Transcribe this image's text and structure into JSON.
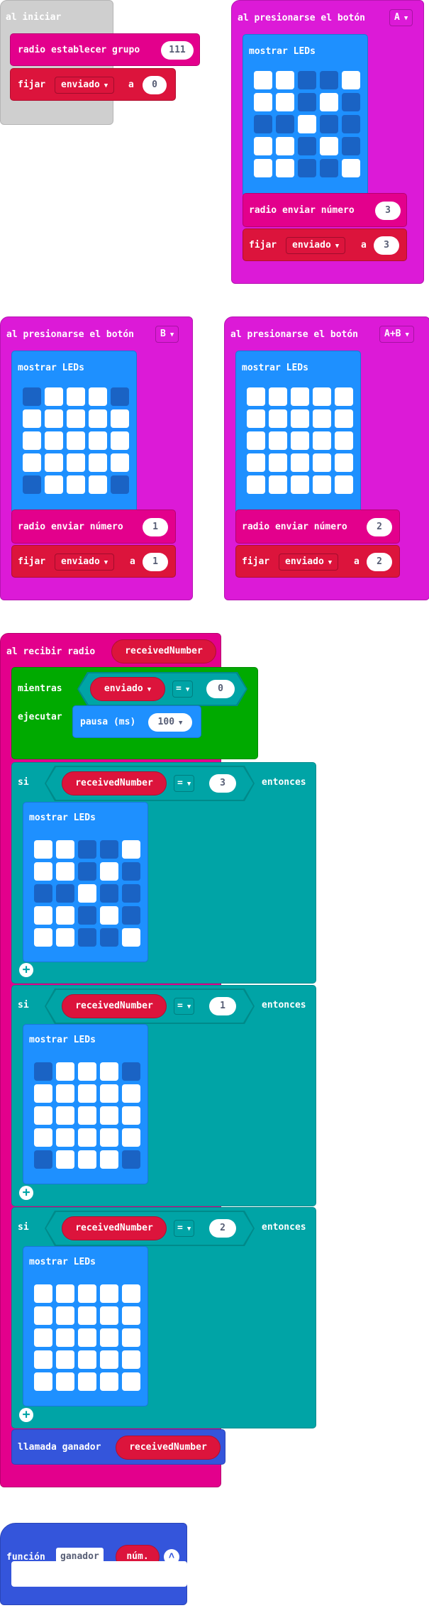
{
  "on_start": {
    "hat_label": "al iniciar",
    "set_group_label": "radio establecer grupo",
    "group_value": "111",
    "set_label": "fijar",
    "variable": "enviado",
    "to_label": "a",
    "set_value": "0"
  },
  "button_a": {
    "hat_label": "al presionarse el botón",
    "button": "A",
    "show_leds_label": "mostrar LEDs",
    "leds": [
      [
        1,
        1,
        0,
        0,
        1
      ],
      [
        1,
        1,
        0,
        1,
        0
      ],
      [
        0,
        0,
        1,
        0,
        0
      ],
      [
        1,
        1,
        0,
        1,
        0
      ],
      [
        1,
        1,
        0,
        0,
        1
      ]
    ],
    "send_label": "radio enviar número",
    "send_value": "3",
    "set_label": "fijar",
    "variable": "enviado",
    "to_label": "a",
    "set_value": "3"
  },
  "button_b": {
    "hat_label": "al presionarse el botón",
    "button": "B",
    "show_leds_label": "mostrar LEDs",
    "leds": [
      [
        0,
        1,
        1,
        1,
        0
      ],
      [
        1,
        1,
        1,
        1,
        1
      ],
      [
        1,
        1,
        1,
        1,
        1
      ],
      [
        1,
        1,
        1,
        1,
        1
      ],
      [
        0,
        1,
        1,
        1,
        0
      ]
    ],
    "send_label": "radio enviar número",
    "send_value": "1",
    "set_label": "fijar",
    "variable": "enviado",
    "to_label": "a",
    "set_value": "1"
  },
  "button_ab": {
    "hat_label": "al presionarse el botón",
    "button": "A+B",
    "show_leds_label": "mostrar LEDs",
    "leds": [
      [
        1,
        1,
        1,
        1,
        1
      ],
      [
        1,
        1,
        1,
        1,
        1
      ],
      [
        1,
        1,
        1,
        1,
        1
      ],
      [
        1,
        1,
        1,
        1,
        1
      ],
      [
        1,
        1,
        1,
        1,
        1
      ]
    ],
    "send_label": "radio enviar número",
    "send_value": "2",
    "set_label": "fijar",
    "variable": "enviado",
    "to_label": "a",
    "set_value": "2"
  },
  "on_received": {
    "hat_label": "al recibir radio",
    "param": "receivedNumber",
    "while_label": "mientras",
    "while_var": "enviado",
    "while_op": "=",
    "while_value": "0",
    "do_label": "ejecutar",
    "pause_label": "pausa (ms)",
    "pause_value": "100",
    "ifs": [
      {
        "if_label": "si",
        "var": "receivedNumber",
        "op": "=",
        "value": "3",
        "then_label": "entonces",
        "show_leds_label": "mostrar LEDs",
        "leds": [
          [
            1,
            1,
            0,
            0,
            1
          ],
          [
            1,
            1,
            0,
            1,
            0
          ],
          [
            0,
            0,
            1,
            0,
            0
          ],
          [
            1,
            1,
            0,
            1,
            0
          ],
          [
            1,
            1,
            0,
            0,
            1
          ]
        ]
      },
      {
        "if_label": "si",
        "var": "receivedNumber",
        "op": "=",
        "value": "1",
        "then_label": "entonces",
        "show_leds_label": "mostrar LEDs",
        "leds": [
          [
            0,
            1,
            1,
            1,
            0
          ],
          [
            1,
            1,
            1,
            1,
            1
          ],
          [
            1,
            1,
            1,
            1,
            1
          ],
          [
            1,
            1,
            1,
            1,
            1
          ],
          [
            0,
            1,
            1,
            1,
            0
          ]
        ]
      },
      {
        "if_label": "si",
        "var": "receivedNumber",
        "op": "=",
        "value": "2",
        "then_label": "entonces",
        "show_leds_label": "mostrar LEDs",
        "leds": [
          [
            1,
            1,
            1,
            1,
            1
          ],
          [
            1,
            1,
            1,
            1,
            1
          ],
          [
            1,
            1,
            1,
            1,
            1
          ],
          [
            1,
            1,
            1,
            1,
            1
          ],
          [
            1,
            1,
            1,
            1,
            1
          ]
        ]
      }
    ],
    "call_label": "llamada ganador",
    "call_arg": "receivedNumber"
  },
  "function_def": {
    "label": "función",
    "name": "ganador",
    "param": "núm."
  },
  "colors": {
    "on_start": "#cfcfcf",
    "radio": "#e3008c",
    "input": "#dc1ad7",
    "variables": "#dc143c",
    "basic": "#1e90ff",
    "loops": "#00aa00",
    "logic": "#00a4a6",
    "functions": "#3455db",
    "led_off": "#1a63c4",
    "led_on": "#ffffff"
  }
}
